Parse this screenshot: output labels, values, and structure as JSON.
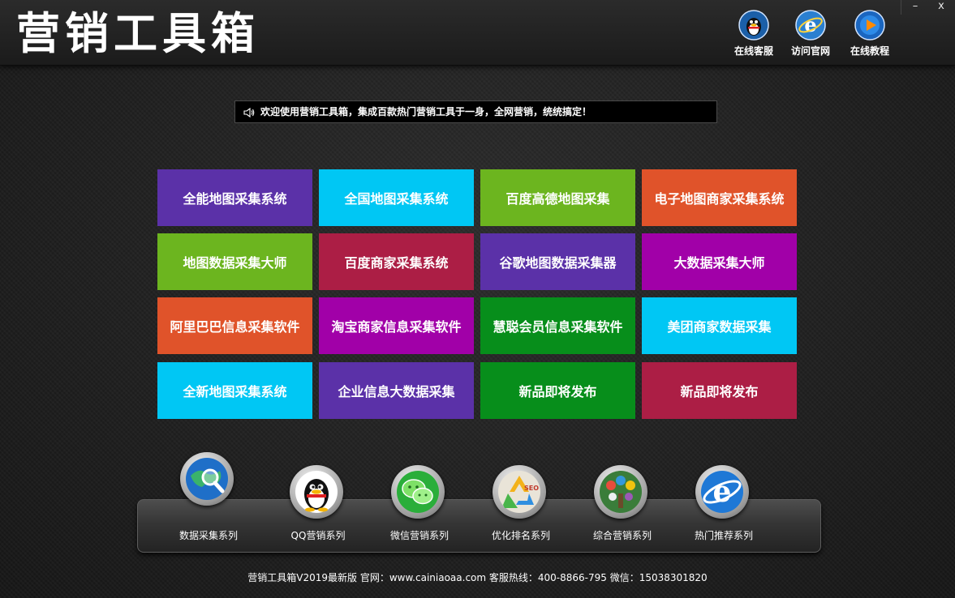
{
  "window": {
    "title": "营销工具箱",
    "minimize_label": "–",
    "close_label": "x"
  },
  "header_links": [
    {
      "label": "在线客服",
      "icon": "qq-penguin-icon"
    },
    {
      "label": "访问官网",
      "icon": "ie-browser-icon"
    },
    {
      "label": "在线教程",
      "icon": "play-icon"
    }
  ],
  "notice": {
    "icon": "speaker-icon",
    "text": "欢迎使用营销工具箱，集成百款热门营销工具于一身，全网营销，统统搞定！"
  },
  "tiles": [
    {
      "label": "全能地图采集系统",
      "color": "#5b31a8"
    },
    {
      "label": "全国地图采集系统",
      "color": "#00c7f4"
    },
    {
      "label": "百度高德地图采集",
      "color": "#6cb51f"
    },
    {
      "label": "电子地图商家采集系统",
      "color": "#e0532a"
    },
    {
      "label": "地图数据采集大师",
      "color": "#6cb51f"
    },
    {
      "label": "百度商家采集系统",
      "color": "#ac1e45"
    },
    {
      "label": "谷歌地图数据采集器",
      "color": "#5b31a8"
    },
    {
      "label": "大数据采集大师",
      "color": "#a100a8"
    },
    {
      "label": "阿里巴巴信息采集软件",
      "color": "#e0532a"
    },
    {
      "label": "淘宝商家信息采集软件",
      "color": "#a100a8"
    },
    {
      "label": "慧聪会员信息采集软件",
      "color": "#078e1b"
    },
    {
      "label": "美团商家数据采集",
      "color": "#00c7f4"
    },
    {
      "label": "全新地图采集系统",
      "color": "#00c7f4"
    },
    {
      "label": "企业信息大数据采集",
      "color": "#5b31a8"
    },
    {
      "label": "新品即将发布",
      "color": "#078e1b"
    },
    {
      "label": "新品即将发布",
      "color": "#ac1e45"
    }
  ],
  "dock": [
    {
      "label": "数据采集系列",
      "icon": "globe-search-icon"
    },
    {
      "label": "QQ营销系列",
      "icon": "qq-penguin-icon"
    },
    {
      "label": "微信营销系列",
      "icon": "wechat-icon"
    },
    {
      "label": "优化排名系列",
      "icon": "seo-recycle-icon"
    },
    {
      "label": "综合营销系列",
      "icon": "social-tree-icon"
    },
    {
      "label": "热门推荐系列",
      "icon": "ie-browser-icon"
    }
  ],
  "footer": {
    "text": "营销工具箱V2019最新版 官网：www.cainiaoaa.com 客服热线：400-8866-795 微信：15038301820"
  }
}
